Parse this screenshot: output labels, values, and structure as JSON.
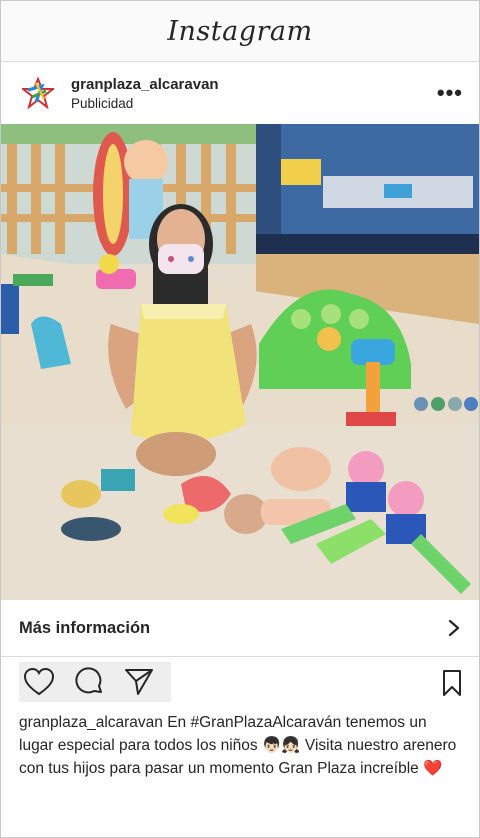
{
  "app": {
    "title": "Instagram"
  },
  "post": {
    "username": "granplaza_alcaravan",
    "sponsored_label": "Publicidad",
    "cta_label": "Más información",
    "caption_user": "granplaza_alcaravan",
    "caption_text": "En #GranPlazaAlcaraván tenemos un lugar especial para todos los niños 👦🏻👧🏻 Visita nuestro arenero con tus hijos para pasar un momento Gran Plaza increíble ❤️"
  },
  "icons": {
    "more": "more-options-icon",
    "like": "heart-icon",
    "comment": "comment-icon",
    "share": "send-icon",
    "save": "bookmark-icon",
    "cta": "chevron-right-icon"
  },
  "colors": {
    "border": "#dbdbdb",
    "text": "#262626",
    "sand": "#e7ddcf"
  }
}
